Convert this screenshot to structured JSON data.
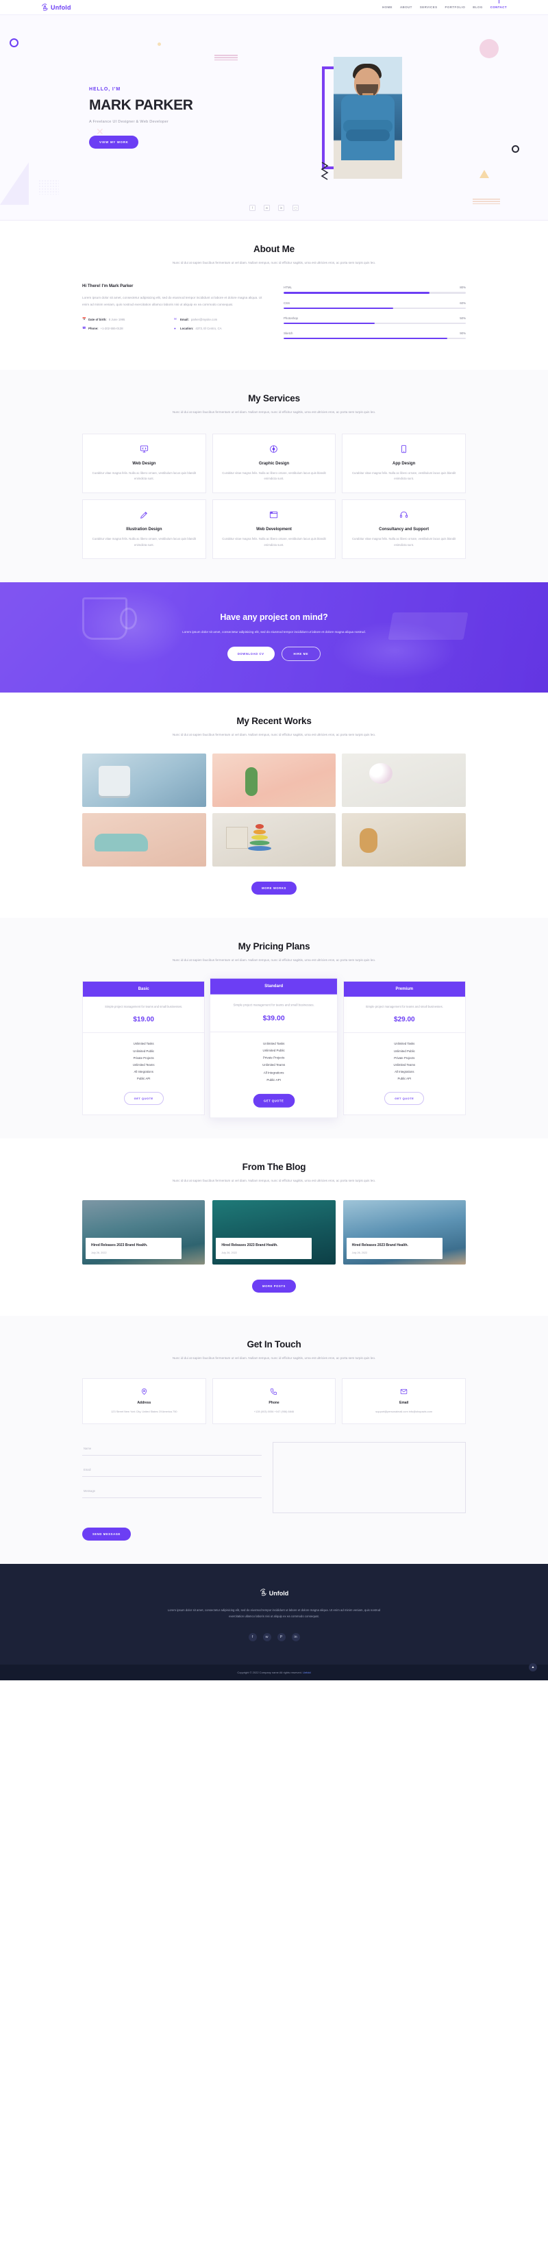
{
  "brand": {
    "name": "Unfold",
    "accent": "#6c3ef4",
    "logo_icon": "unfold-logo-icon"
  },
  "nav": {
    "items": [
      {
        "label": "HOME",
        "active": false
      },
      {
        "label": "ABOUT",
        "active": false
      },
      {
        "label": "SERVICES",
        "active": false
      },
      {
        "label": "PORTFOLIO",
        "active": false
      },
      {
        "label": "BLOG",
        "active": false
      },
      {
        "label": "CONTACT",
        "active": true
      }
    ]
  },
  "hero": {
    "greeting": "HELLO, I'M",
    "name": "MARK PARKER",
    "subtitle": "A Freelance UI Designer & Web Developer",
    "cta_label": "VIEW MY WORK",
    "socials": [
      "facebook-icon",
      "twitter-icon",
      "linkedin-icon",
      "instagram-icon"
    ]
  },
  "about": {
    "title": "About Me",
    "subtitle": "Nunc id dui at sapien faucibus fermentum ut vel diam. Nullam tempus, nunc id efficitur sagittis, urna est ultricies eros, ac porta sem turpis quis leo.",
    "heading": "Hi There! I'm Mark Parker",
    "paragraph": "Lorem ipsum dolor sit amet, consectetur adipisicing elit, sed do eiusmod tempor incididunt ut labore et dolore magna aliqua. Ut enim ad minim veniam, quis nostrud exercitation ullamco laboris nisi ut aliquip ex ea commodo consequat.",
    "info": [
      {
        "icon": "calendar-icon",
        "label": "Date of birth:",
        "value": "8 June 1995"
      },
      {
        "icon": "mail-icon",
        "label": "Email:",
        "value": "parker@mysite.com"
      },
      {
        "icon": "phone-icon",
        "label": "Phone:",
        "value": "+1-202-555-0138"
      },
      {
        "icon": "location-pin-icon",
        "label": "Location:",
        "value": "4373, El Centro, CA"
      }
    ],
    "skills": [
      {
        "name": "HTML",
        "percent": 80,
        "percent_label": "80%"
      },
      {
        "name": "CSS",
        "percent": 60,
        "percent_label": "60%"
      },
      {
        "name": "Photoshop",
        "percent": 50,
        "percent_label": "50%"
      },
      {
        "name": "Sketch",
        "percent": 90,
        "percent_label": "90%"
      }
    ]
  },
  "services": {
    "title": "My Services",
    "subtitle": "Nunc id dui at sapien faucibus fermentum ut vel diam. Nullam tempus, nunc id efficitur sagittis, urna est ultricies eros, ac porta sem turpis quis leo.",
    "items": [
      {
        "icon": "code-screen-icon",
        "name": "Web Design",
        "desc": "Curabitur vitae magna felis. Nulla ac libero ornare, vestibulum lacus quis blandit enimdicta sunt."
      },
      {
        "icon": "palette-icon",
        "name": "Graphic Design",
        "desc": "Curabitur vitae magna felis. Nulla ac libero ornare, vestibulum lacus quis blandit enimdicta sunt."
      },
      {
        "icon": "mobile-phone-icon",
        "name": "App Design",
        "desc": "Curabitur vitae magna felis. Nulla ac libero ornare, vestibulum lacus quis blandit enimdicta sunt."
      },
      {
        "icon": "pen-tool-icon",
        "name": "Illustration Design",
        "desc": "Curabitur vitae magna felis. Nulla ac libero ornare, vestibulum lacus quis blandit enimdicta sunt."
      },
      {
        "icon": "browser-icon",
        "name": "Web Development",
        "desc": "Curabitur vitae magna felis. Nulla ac libero ornare, vestibulum lacus quis blandit enimdicta sunt."
      },
      {
        "icon": "headset-icon",
        "name": "Consultancy and Support",
        "desc": "Curabitur vitae magna felis. Nulla ac libero ornare, vestibulum lacus quis blandit enimdicta sunt."
      }
    ]
  },
  "cta": {
    "title": "Have any project on mind?",
    "text": "Lorem ipsum dolor sit amet, consectetur adipisicing elit, sed do eiusmod tempor incididunt ut labore et dolore magna aliqua nostrud.",
    "primary_label": "DOWNLOAD CV",
    "secondary_label": "HIRE ME"
  },
  "works": {
    "title": "My Recent Works",
    "subtitle": "Nunc id dui at sapien faucibus fermentum ut vel diam. Nullam tempus, nunc id efficitur sagittis, urna est ultricies eros, ac porta sem turpis quis leo.",
    "more_label": "MORE WORKS",
    "items": [
      {
        "alt": "blue-toy-robot-photo"
      },
      {
        "alt": "cactus-in-vase-photo"
      },
      {
        "alt": "white-flowers-vase-photo"
      },
      {
        "alt": "vintage-toy-car-photo"
      },
      {
        "alt": "wooden-alphabet-blocks-photo"
      },
      {
        "alt": "teddy-bear-and-toys-photo"
      }
    ]
  },
  "pricing": {
    "title": "My Pricing Plans",
    "subtitle": "Nunc id dui at sapien faucibus fermentum ut vel diam. Nullam tempus, nunc id efficitur sagittis, urna est ultricies eros, ac porta sem turpis quis leo.",
    "plans": [
      {
        "name": "Basic",
        "desc": "Simple project management for teams and small businesses.",
        "price": "$19.00",
        "features": [
          "Unlimited Tasks",
          "Unlimited Public",
          "Private Projects",
          "Unlimited Teams",
          "All Integrations",
          "Public API"
        ],
        "button": "GET QUOTE",
        "featured": false
      },
      {
        "name": "Standard",
        "desc": "Simple project management for teams and small businesses.",
        "price": "$39.00",
        "features": [
          "Unlimited Tasks",
          "Unlimited Public",
          "Private Projects",
          "Unlimited Teams",
          "All Integrations",
          "Public API"
        ],
        "button": "GET QUOTE",
        "featured": true
      },
      {
        "name": "Premium",
        "desc": "Simple project management for teams and small businesses.",
        "price": "$29.00",
        "features": [
          "Unlimited Tasks",
          "Unlimited Public",
          "Private Projects",
          "Unlimited Teams",
          "All Integrations",
          "Public API"
        ],
        "button": "GET QUOTE",
        "featured": false
      }
    ]
  },
  "blog": {
    "title": "From The Blog",
    "subtitle": "Nunc id dui at sapien faucibus fermentum ut vel diam. Nullam tempus, nunc id efficitur sagittis, urna est ultricies eros, ac porta sem turpis quis leo.",
    "more_label": "MORE POSTS",
    "posts": [
      {
        "title": "Hired Releases 2023 Brand Health.",
        "date": "July 26, 2022",
        "alt": "mountain-lake-photo"
      },
      {
        "title": "Hired Releases 2023 Brand Health.",
        "date": "July 26, 2022",
        "alt": "turquoise-sea-photo"
      },
      {
        "title": "Hired Releases 2023 Brand Health.",
        "date": "July 26, 2022",
        "alt": "lakeside-cabins-photo"
      }
    ]
  },
  "contact": {
    "title": "Get In Touch",
    "subtitle": "Nunc id dui at sapien faucibus fermentum ut vel diam. Nullam tempus, nunc id efficitur sagittis, urna est ultricies eros, ac porta sem turpis quis leo.",
    "cards": [
      {
        "icon": "location-pin-icon",
        "name": "Address",
        "value": "123 Street New York City, United States Of America 750"
      },
      {
        "icon": "phone-icon",
        "name": "Phone",
        "value": "+128 (003) 0056\n+047 (956) 6846"
      },
      {
        "icon": "mail-icon",
        "name": "Email",
        "value": "support@personalmail.com\ninfo@shopacts.com"
      }
    ],
    "form": {
      "name_placeholder": "Name",
      "email_placeholder": "Email",
      "message_placeholder": "Message",
      "textarea_placeholder": "",
      "submit_label": "SEND MESSAGE"
    }
  },
  "footer": {
    "brand": "Unfold",
    "text": "Lorem ipsum dolor sit amet, consectetur adipisicing elit, sed do eiusmod tempor incididunt ut labore et dolore magna aliqua. Ut enim ad minim veniam, quis nostrud exercitation ullamco laboris nisi ut aliquip ex ea commodo consequat.",
    "socials": [
      "facebook-icon",
      "twitter-icon",
      "pinterest-icon",
      "linkedin-icon"
    ],
    "copyright_prefix": "Copyright © 2022 Company name All rights reserved.",
    "copyright_link": "Unfold",
    "back_to_top": "back-to-top-icon"
  }
}
